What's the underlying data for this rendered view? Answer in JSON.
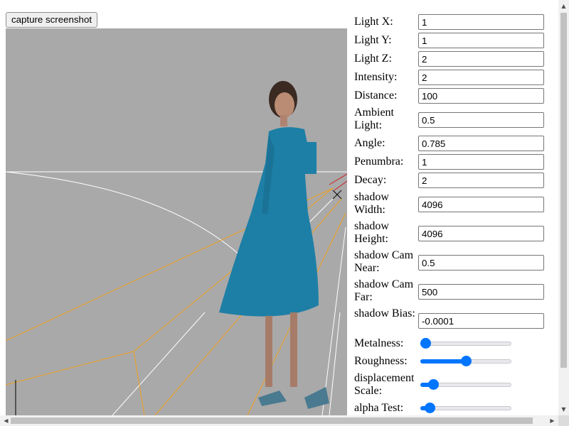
{
  "toolbar": {
    "capture_label": "capture screenshot"
  },
  "colors": {
    "viewport_bg": "#a9a9a9",
    "helper_line": "#ffffff",
    "spotlight_cone": "#f0a020",
    "accent": "#0075ff",
    "dress": "#1d7fa6"
  },
  "panel": {
    "light_x": {
      "label": "Light X:",
      "value": "1"
    },
    "light_y": {
      "label": "Light Y:",
      "value": "1"
    },
    "light_z": {
      "label": "Light Z:",
      "value": "2"
    },
    "intensity": {
      "label": "Intensity:",
      "value": "2"
    },
    "distance": {
      "label": "Distance:",
      "value": "100"
    },
    "ambient": {
      "label": "Ambient Light:",
      "value": "0.5"
    },
    "angle": {
      "label": "Angle:",
      "value": "0.785"
    },
    "penumbra": {
      "label": "Penumbra:",
      "value": "1"
    },
    "decay": {
      "label": "Decay:",
      "value": "2"
    },
    "shadow_width": {
      "label": "shadow Width:",
      "value": "4096"
    },
    "shadow_height": {
      "label": "shadow Height:",
      "value": "4096"
    },
    "shadow_cam_near": {
      "label": "shadow Cam Near:",
      "value": "0.5"
    },
    "shadow_cam_far": {
      "label": "shadow Cam Far:",
      "value": "500"
    },
    "shadow_bias": {
      "label": "shadow Bias:",
      "value": "-0.0001"
    },
    "metalness": {
      "label": "Metalness:",
      "level": 0.0
    },
    "roughness": {
      "label": "Roughness:",
      "level": 0.5
    },
    "displacement_scale": {
      "label": "displacement Scale:",
      "level": 0.1
    },
    "alpha_test": {
      "label": "alpha Test:",
      "level": 0.05
    }
  },
  "icons": {
    "scroll_up": "▲",
    "scroll_down": "▼",
    "scroll_left": "◀",
    "scroll_right": "▶"
  }
}
